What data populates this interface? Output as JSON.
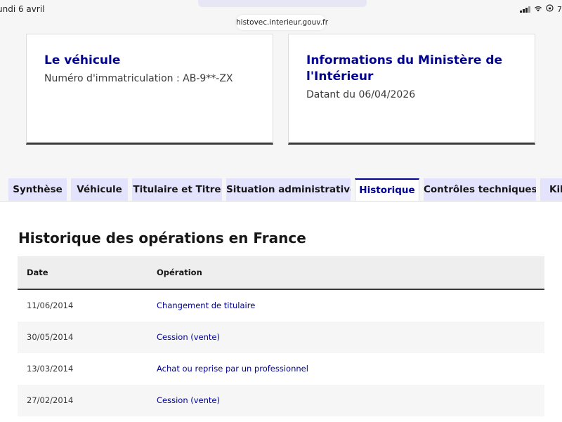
{
  "status_bar": {
    "date": "undi 6 avril",
    "battery": "7"
  },
  "browser": {
    "url": "histovec.interieur.gouv.fr"
  },
  "cards": {
    "vehicle": {
      "title": "Le véhicule",
      "plate_text": "Numéro d'immatriculation : AB-9**-ZX"
    },
    "ministry": {
      "title_line1": "Informations du Ministère de",
      "title_line2": "l'Intérieur",
      "date_text": "Datant du 06/04/2026"
    }
  },
  "tabs": [
    {
      "label": "Synthèse",
      "active": false
    },
    {
      "label": "Véhicule",
      "active": false
    },
    {
      "label": "Titulaire et Titre",
      "active": false
    },
    {
      "label": "Situation administrative",
      "active": false
    },
    {
      "label": "Historique",
      "active": true
    },
    {
      "label": "Contrôles techniques",
      "active": false
    },
    {
      "label": "Kilo",
      "active": false
    }
  ],
  "history": {
    "title": "Historique des opérations en France",
    "columns": [
      "Date",
      "Opération"
    ],
    "rows": [
      {
        "date": "11/06/2014",
        "operation": "Changement de titulaire"
      },
      {
        "date": "30/05/2014",
        "operation": "Cession (vente)"
      },
      {
        "date": "13/03/2014",
        "operation": "Achat ou reprise par un professionnel"
      },
      {
        "date": "27/02/2014",
        "operation": "Cession (vente)"
      }
    ]
  },
  "colors": {
    "accent": "#000091",
    "tab_bg": "#e3e3fd",
    "text": "#161616"
  }
}
